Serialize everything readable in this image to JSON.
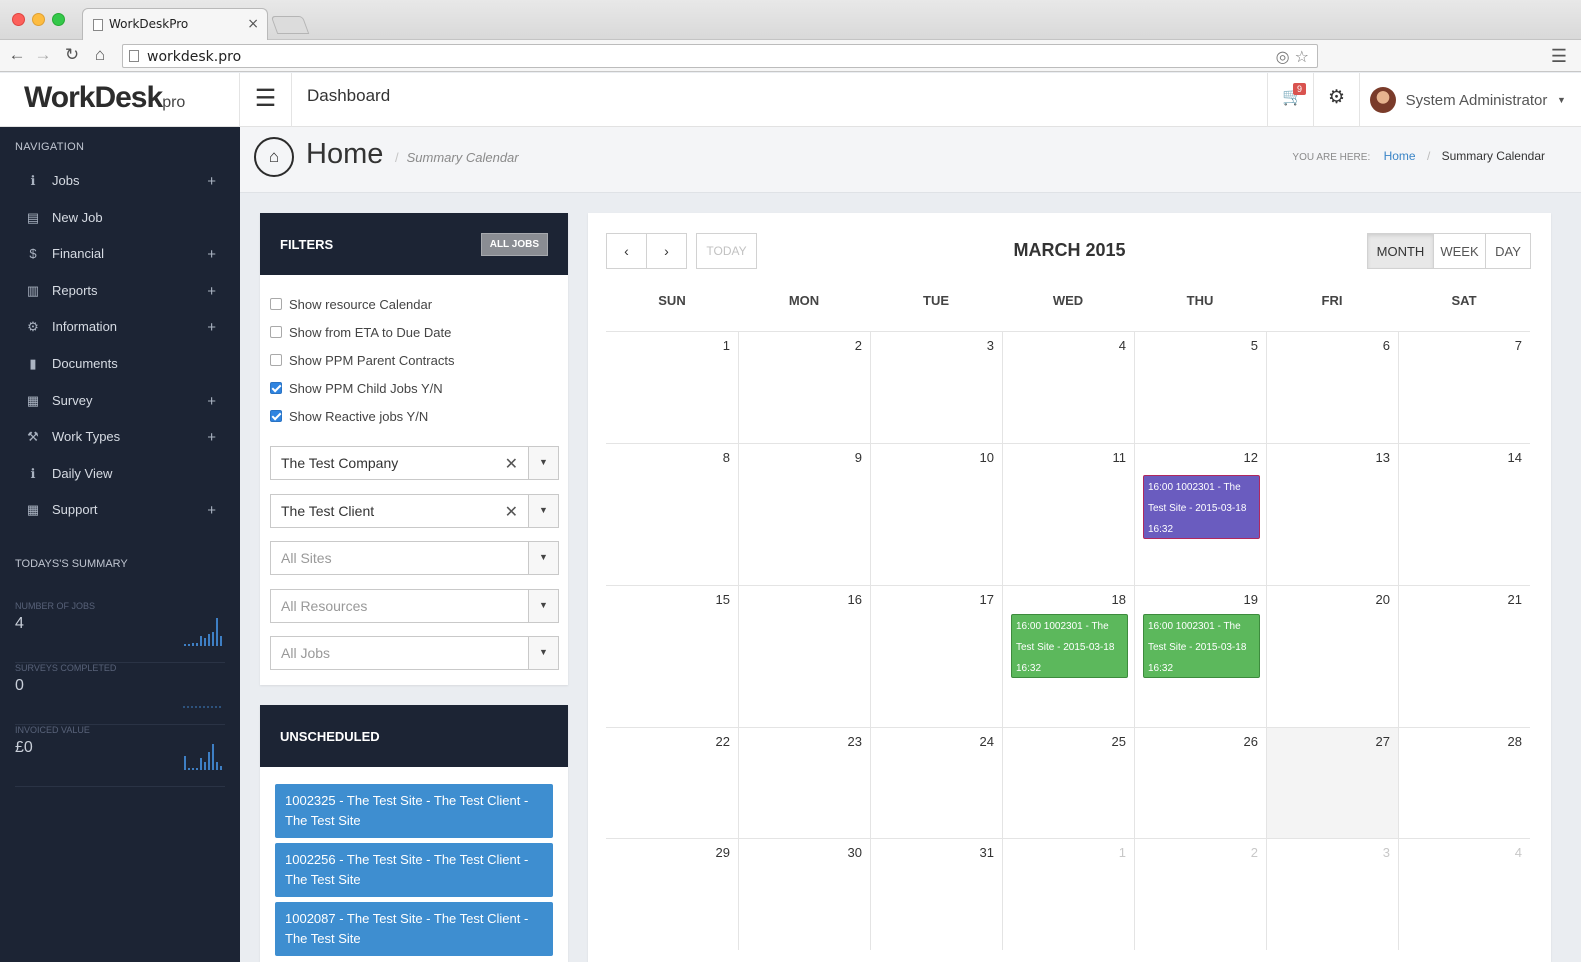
{
  "browser": {
    "tab_title": "WorkDeskPro",
    "url": "workdesk.pro"
  },
  "header": {
    "logo": "WorkDesk",
    "logo_suffix": "pro",
    "title": "Dashboard",
    "cart_count": "9",
    "user_name": "System Administrator"
  },
  "sidebar": {
    "heading": "NAVIGATION",
    "items": [
      {
        "label": "Jobs",
        "icon": "info-icon",
        "expandable": true
      },
      {
        "label": "New Job",
        "icon": "server-icon",
        "expandable": false
      },
      {
        "label": "Financial",
        "icon": "dollar-icon",
        "expandable": true
      },
      {
        "label": "Reports",
        "icon": "bar-chart-icon",
        "expandable": true
      },
      {
        "label": "Information",
        "icon": "cogs-icon",
        "expandable": true
      },
      {
        "label": "Documents",
        "icon": "file-icon",
        "expandable": false
      },
      {
        "label": "Survey",
        "icon": "list-icon",
        "expandable": true
      },
      {
        "label": "Work Types",
        "icon": "gavel-icon",
        "expandable": true
      },
      {
        "label": "Daily View",
        "icon": "info-icon",
        "expandable": false
      },
      {
        "label": "Support",
        "icon": "list-icon",
        "expandable": true
      }
    ],
    "summary_heading": "TODAYS'S SUMMARY",
    "summary": [
      {
        "label": "NUMBER OF JOBS",
        "value": "4"
      },
      {
        "label": "SURVEYS COMPLETED",
        "value": "0"
      },
      {
        "label": "INVOICED VALUE",
        "value": "£0"
      }
    ]
  },
  "page": {
    "title": "Home",
    "subtitle": "Summary Calendar",
    "breadcrumb_prefix": "YOU ARE HERE:",
    "breadcrumb_home": "Home",
    "breadcrumb_current": "Summary Calendar"
  },
  "filters": {
    "heading": "FILTERS",
    "all_jobs_button": "ALL JOBS",
    "checkboxes": [
      {
        "label": "Show resource Calendar",
        "checked": false
      },
      {
        "label": "Show from ETA to Due Date",
        "checked": false
      },
      {
        "label": "Show PPM Parent Contracts",
        "checked": false
      },
      {
        "label": "Show PPM Child Jobs Y/N",
        "checked": true
      },
      {
        "label": "Show Reactive jobs Y/N",
        "checked": true
      }
    ],
    "selects": {
      "company": "The Test Company",
      "client": "The Test Client",
      "sites": "All Sites",
      "resources": "All Resources",
      "jobs": "All Jobs"
    }
  },
  "unscheduled": {
    "heading": "UNSCHEDULED",
    "items": [
      "1002325 - The Test Site - The Test Client - The Test Site",
      "1002256 - The Test Site - The Test Client - The Test Site",
      "1002087 - The Test Site - The Test Client - The Test Site"
    ]
  },
  "calendar": {
    "title": "MARCH 2015",
    "today_label": "TODAY",
    "views": [
      "MONTH",
      "WEEK",
      "DAY"
    ],
    "active_view": "MONTH",
    "days_of_week": [
      "SUN",
      "MON",
      "TUE",
      "WED",
      "THU",
      "FRI",
      "SAT"
    ],
    "weeks": [
      [
        "1",
        "2",
        "3",
        "4",
        "5",
        "6",
        "7"
      ],
      [
        "8",
        "9",
        "10",
        "11",
        "12",
        "13",
        "14"
      ],
      [
        "15",
        "16",
        "17",
        "18",
        "19",
        "20",
        "21"
      ],
      [
        "22",
        "23",
        "24",
        "25",
        "26",
        "27",
        "28"
      ],
      [
        "29",
        "30",
        "31",
        "1",
        "2",
        "3",
        "4"
      ]
    ],
    "events": {
      "mar12": "16:00  1002301 - The Test Site - 2015-03-18 16:32",
      "mar18": "16:00  1002301 - The Test Site - 2015-03-18 16:32",
      "mar19": "16:00  1002301 - The Test Site - 2015-03-18 16:32"
    },
    "event_colors": {
      "mar12": "#6a5cbf",
      "mar18": "#5cb85c",
      "mar19": "#5cb85c"
    }
  }
}
